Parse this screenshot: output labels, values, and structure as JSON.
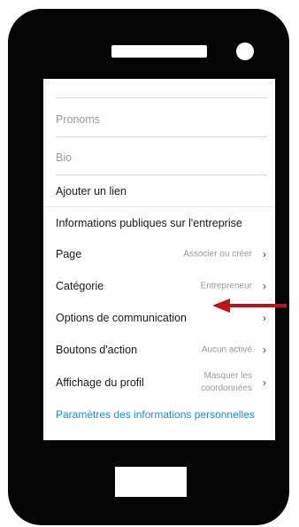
{
  "profile": {
    "pronouns_placeholder": "Pronoms",
    "bio_placeholder": "Bio",
    "add_link_label": "Ajouter un lien",
    "business_section_title": "Informations publiques sur l'entreprise"
  },
  "rows": [
    {
      "label": "Page",
      "value": "Associer ou créer"
    },
    {
      "label": "Catégorie",
      "value": "Entrepreneur"
    },
    {
      "label": "Options de communication",
      "value": ""
    },
    {
      "label": "Boutons d'action",
      "value": "Aucun activé"
    },
    {
      "label": "Affichage du profil",
      "value": "Masquer les coordonnées"
    }
  ],
  "personal_info_link": "Paramètres des informations personnelles",
  "chevron": "›",
  "colors": {
    "link_blue": "#1e8bd8",
    "arrow_red": "#c0121a",
    "phone_body": "#050505"
  }
}
